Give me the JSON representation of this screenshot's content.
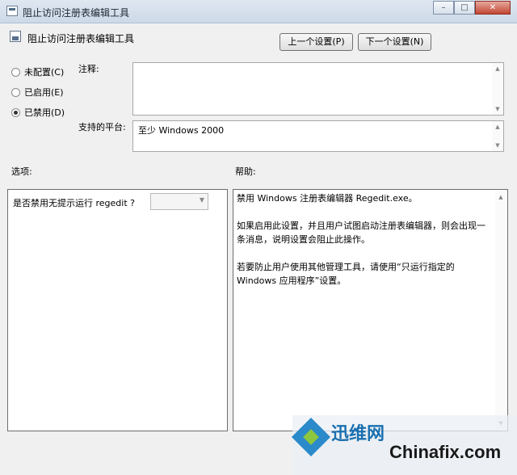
{
  "window": {
    "title": "阻止访问注册表编辑工具",
    "min_label": "–",
    "max_label": "□",
    "close_label": "✕"
  },
  "header": {
    "policy_title": "阻止访问注册表编辑工具",
    "prev_button": "上一个设置(P)",
    "next_button": "下一个设置(N)"
  },
  "state": {
    "options": [
      {
        "label": "未配置(C)",
        "selected": false
      },
      {
        "label": "已启用(E)",
        "selected": false
      },
      {
        "label": "已禁用(D)",
        "selected": true
      }
    ]
  },
  "comment": {
    "label": "注释:",
    "value": ""
  },
  "platform": {
    "label": "支持的平台:",
    "value": "至少 Windows 2000"
  },
  "options_panel": {
    "heading": "选项:",
    "question": "是否禁用无提示运行 regedit ?",
    "dropdown_value": ""
  },
  "help_panel": {
    "heading": "帮助:",
    "paragraphs": [
      "禁用 Windows 注册表编辑器 Regedit.exe。",
      "如果启用此设置，并且用户试图启动注册表编辑器，则会出现一条消息，说明设置会阻止此操作。",
      "若要防止用户使用其他管理工具，请使用“只运行指定的 Windows 应用程序”设置。"
    ]
  },
  "watermark": {
    "cn": "迅维网",
    "en": "Chinafix.com"
  }
}
